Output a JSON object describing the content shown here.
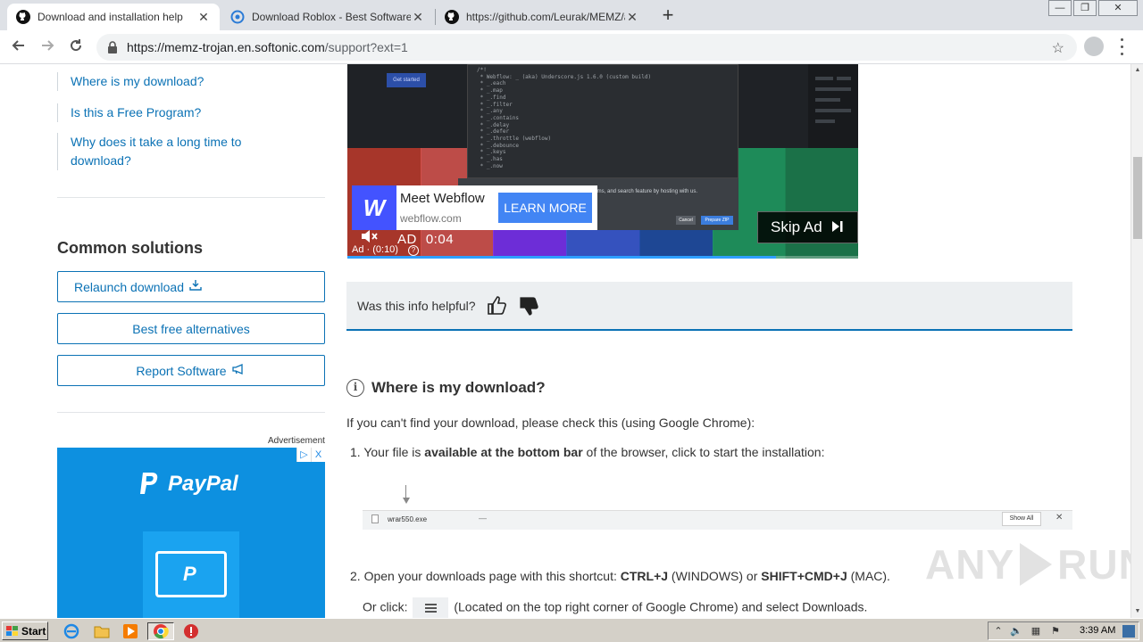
{
  "browser": {
    "tabs": [
      {
        "title": "Download and installation help",
        "active": true,
        "favicon": "github-icon"
      },
      {
        "title": "Download Roblox - Best Software &",
        "active": false,
        "favicon": "softonic-icon"
      },
      {
        "title": "https://github.com/Leurak/MEMZ/ar",
        "active": false,
        "favicon": "github-icon"
      }
    ],
    "close_symbol": "✕",
    "new_tab_symbol": "+",
    "url_host": "https://memz-trojan.en.softonic.com",
    "url_path": "/support?ext=1"
  },
  "sidebar": {
    "faq_links": [
      "Where is my download?",
      "Is this a Free Program?",
      "Why does it take a long time to download?"
    ],
    "common_heading": "Common solutions",
    "buttons": {
      "relaunch": "Relaunch download",
      "alternatives": "Best free alternatives",
      "report": "Report Software"
    },
    "ad_label": "Advertisement",
    "paypal": {
      "brand": "PayPal",
      "adchoices": [
        "▷",
        "X"
      ]
    }
  },
  "video_ad": {
    "code_lines": [
      "/*!",
      " * Webflow: _ (aka) Underscore.js 1.6.0 (custom build)",
      " * _.each",
      " * _.map",
      " * _.find",
      " * _.filter",
      " * _.any",
      " * _.contains",
      " * _.delay",
      " * _.defer",
      " * _.throttle (webflow)",
      " * _.debounce",
      " * _.keys",
      " * _.has",
      " * _.now"
    ],
    "dialog_text": "CMS, forms, and search feature by hosting with us.",
    "cancel": "Cancel",
    "prepare": "Prepare ZIP",
    "blue_chip": "Get started",
    "advertiser_title": "Meet Webflow",
    "advertiser_site": "webflow.com",
    "cta": "LEARN MORE",
    "ad_tag": "AD",
    "time": "0:04",
    "counter": "Ad · (0:10)",
    "help": "?",
    "skip": "Skip Ad",
    "progress": 0.84,
    "tile_colors": [
      "#c0392b",
      "#d9534f",
      "#7b2ff7",
      "#3a5bd9",
      "#1f4ea8",
      "#1e9e63",
      "#1b7f4f"
    ]
  },
  "feedback": {
    "question": "Was this info helpful?"
  },
  "article": {
    "heading": "Where is my download?",
    "intro": "If you can't find your download, please check this (using Google Chrome):",
    "step1": {
      "num": "1.",
      "pre": "Your file is ",
      "bold": "available at the bottom bar",
      "post": " of the browser, click to start the installation:"
    },
    "download_bar": {
      "file": "wrar550.exe",
      "show_all": "Show All",
      "close": "✕",
      "dash": "—"
    },
    "step2": {
      "num": "2.",
      "pre": "Open your downloads page with this shortcut: ",
      "bold1": "CTRL+J",
      "mid": " (WINDOWS) or ",
      "bold2": "SHIFT+CMD+J",
      "post": " (MAC)."
    },
    "step3": {
      "pre": "Or click: ",
      "post": " (Located on the top right corner of Google Chrome) and select Downloads."
    }
  },
  "watermark": {
    "left": "ANY",
    "right": "RUN"
  },
  "taskbar": {
    "start": "Start",
    "clock": "3:39 AM"
  }
}
